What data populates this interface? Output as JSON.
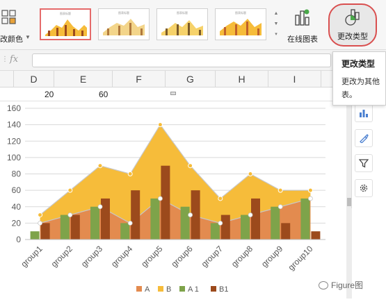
{
  "ribbon": {
    "color_button_label": "改颜色",
    "thumbnails": [
      {
        "title": "图表标题",
        "selected": true
      },
      {
        "title": "图表标题",
        "selected": false
      },
      {
        "title": "图表标题",
        "selected": false
      },
      {
        "title": "图表标题",
        "selected": false
      }
    ],
    "online_chart_label": "在线图表",
    "change_type_label": "更改类型"
  },
  "formula_bar": {
    "fx": "fx",
    "value": ""
  },
  "columns": [
    "D",
    "E",
    "F",
    "G",
    "H",
    "I"
  ],
  "cell_values": [
    "20",
    "60"
  ],
  "tooltip": {
    "title": "更改类型",
    "description": "更改为其他表。"
  },
  "watermark": "Figure图",
  "colors": {
    "A": "#e38b4f",
    "B": "#f6bc3a",
    "A1": "#7ea34a",
    "B1": "#9c4a1c",
    "line": "#c7c7c7",
    "highlight": "#d94f4f"
  },
  "chart_data": {
    "type": "bar",
    "categories": [
      "group1",
      "group2",
      "group3",
      "group4",
      "group5",
      "group6",
      "group7",
      "group8",
      "group9",
      "group10"
    ],
    "series": [
      {
        "name": "A",
        "type": "area",
        "values": [
          20,
          30,
          40,
          20,
          50,
          30,
          20,
          30,
          40,
          50
        ]
      },
      {
        "name": "B",
        "type": "area",
        "values": [
          30,
          60,
          90,
          80,
          140,
          90,
          50,
          80,
          60,
          60
        ]
      },
      {
        "name": "A 1",
        "type": "bar",
        "values": [
          10,
          30,
          40,
          20,
          50,
          40,
          20,
          30,
          40,
          50
        ]
      },
      {
        "name": "B1",
        "type": "bar",
        "values": [
          20,
          30,
          50,
          60,
          90,
          60,
          30,
          50,
          20,
          10
        ]
      }
    ],
    "ylim": [
      0,
      160
    ],
    "yticks": [
      0,
      20,
      40,
      60,
      80,
      100,
      120,
      140,
      160
    ],
    "grid": true,
    "legend": "bottom"
  }
}
